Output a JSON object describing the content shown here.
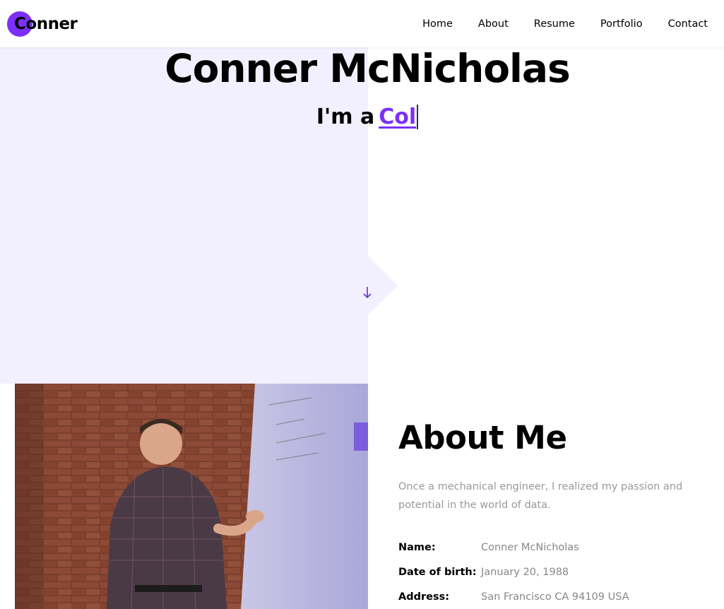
{
  "navbar": {
    "logo_text": "onner",
    "logo_letter": "C",
    "links": [
      "Home",
      "About",
      "Resume",
      "Portfolio",
      "Contact"
    ]
  },
  "hero": {
    "name": "Conner McNicholas",
    "subtitle_lead": "I'm a",
    "subtitle_typed": "Col",
    "scroll_icon": "arrow-down-icon"
  },
  "about": {
    "title": "About Me",
    "description": "Once a mechanical engineer, I realized my passion and potential in the world of data.",
    "info": [
      {
        "label": "Name:",
        "value": "Conner McNicholas"
      },
      {
        "label": "Date of birth:",
        "value": "January 20, 1988"
      },
      {
        "label": "Address:",
        "value": "San Francisco CA 94109 USA"
      }
    ]
  },
  "colors": {
    "accent": "#7b2ff7",
    "hero_bg": "#f2f0fe",
    "muted_text": "#999999"
  }
}
